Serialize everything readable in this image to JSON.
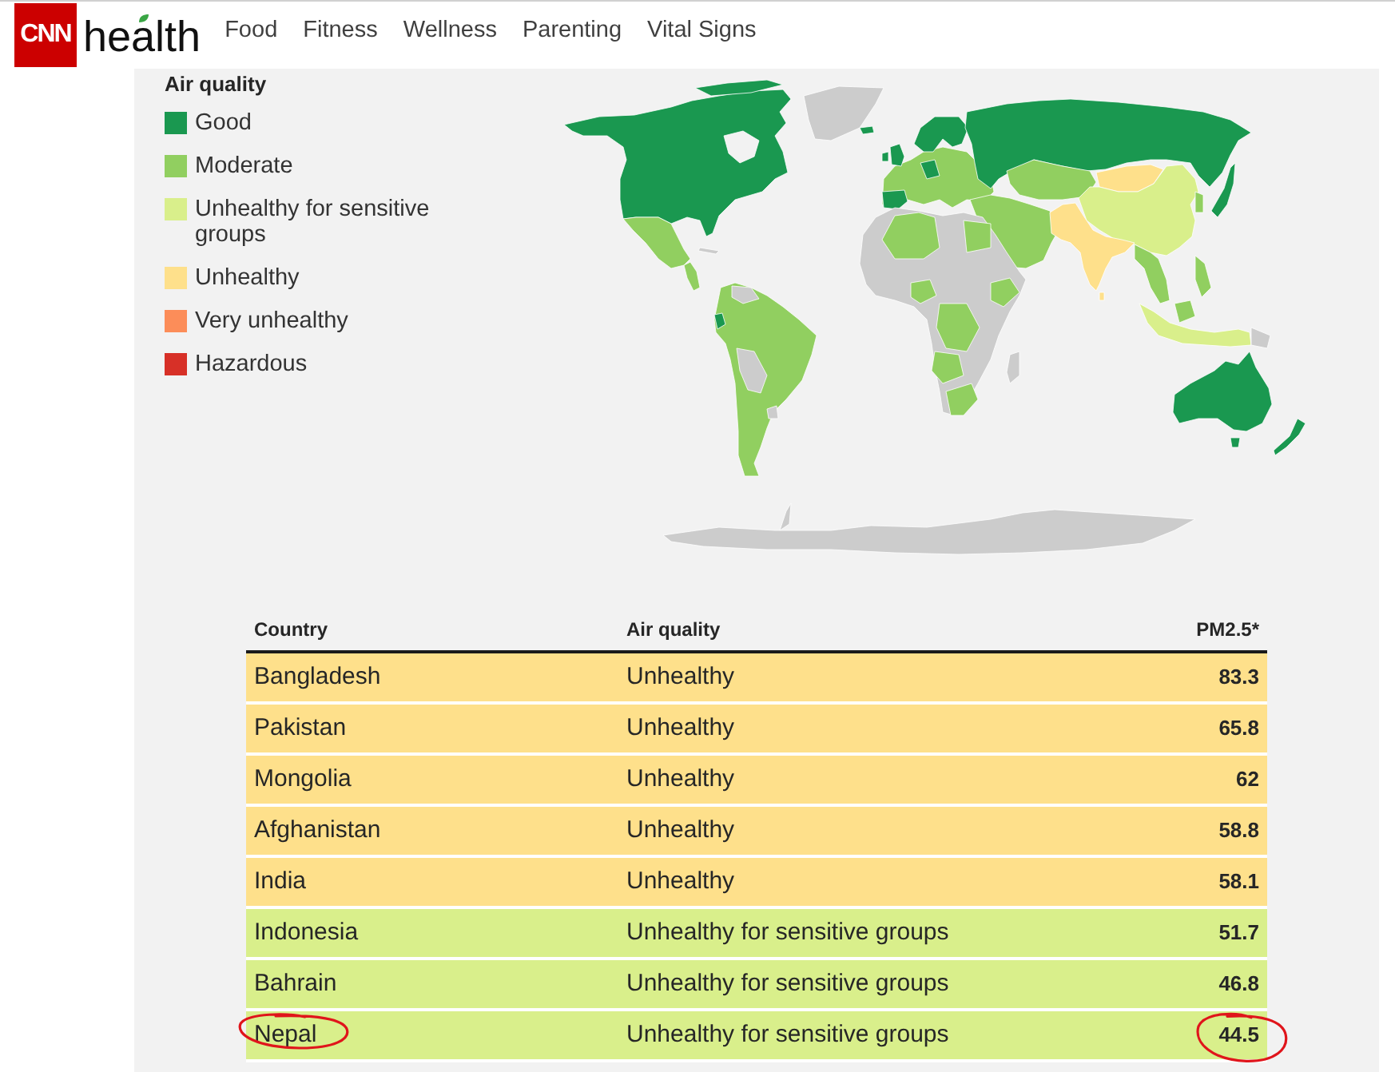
{
  "header": {
    "logo": {
      "brand": "CNN",
      "section": "health"
    },
    "nav": [
      "Food",
      "Fitness",
      "Wellness",
      "Parenting",
      "Vital Signs"
    ]
  },
  "legend": {
    "title": "Air quality",
    "items": [
      {
        "label": "Good",
        "color": "#1a9850"
      },
      {
        "label": "Moderate",
        "color": "#91cf60"
      },
      {
        "label": "Unhealthy for sensitive groups",
        "color": "#d9ef8b"
      },
      {
        "label": "Unhealthy",
        "color": "#fee08b"
      },
      {
        "label": "Very unhealthy",
        "color": "#fc8d59"
      },
      {
        "label": "Hazardous",
        "color": "#d73027"
      }
    ]
  },
  "table": {
    "columns": [
      "Country",
      "Air quality",
      "PM2.5*"
    ],
    "rows": [
      {
        "country": "Bangladesh",
        "air_quality": "Unhealthy",
        "pm25": "83.3",
        "color": "#fee08b",
        "circled": false
      },
      {
        "country": "Pakistan",
        "air_quality": "Unhealthy",
        "pm25": "65.8",
        "color": "#fee08b",
        "circled": false
      },
      {
        "country": "Mongolia",
        "air_quality": "Unhealthy",
        "pm25": "62",
        "color": "#fee08b",
        "circled": false
      },
      {
        "country": "Afghanistan",
        "air_quality": "Unhealthy",
        "pm25": "58.8",
        "color": "#fee08b",
        "circled": false
      },
      {
        "country": "India",
        "air_quality": "Unhealthy",
        "pm25": "58.1",
        "color": "#fee08b",
        "circled": false
      },
      {
        "country": "Indonesia",
        "air_quality": "Unhealthy for sensitive groups",
        "pm25": "51.7",
        "color": "#d9ef8b",
        "circled": false
      },
      {
        "country": "Bahrain",
        "air_quality": "Unhealthy for sensitive groups",
        "pm25": "46.8",
        "color": "#d9ef8b",
        "circled": false
      },
      {
        "country": "Nepal",
        "air_quality": "Unhealthy for sensitive groups",
        "pm25": "44.5",
        "color": "#d9ef8b",
        "circled": true
      }
    ]
  }
}
